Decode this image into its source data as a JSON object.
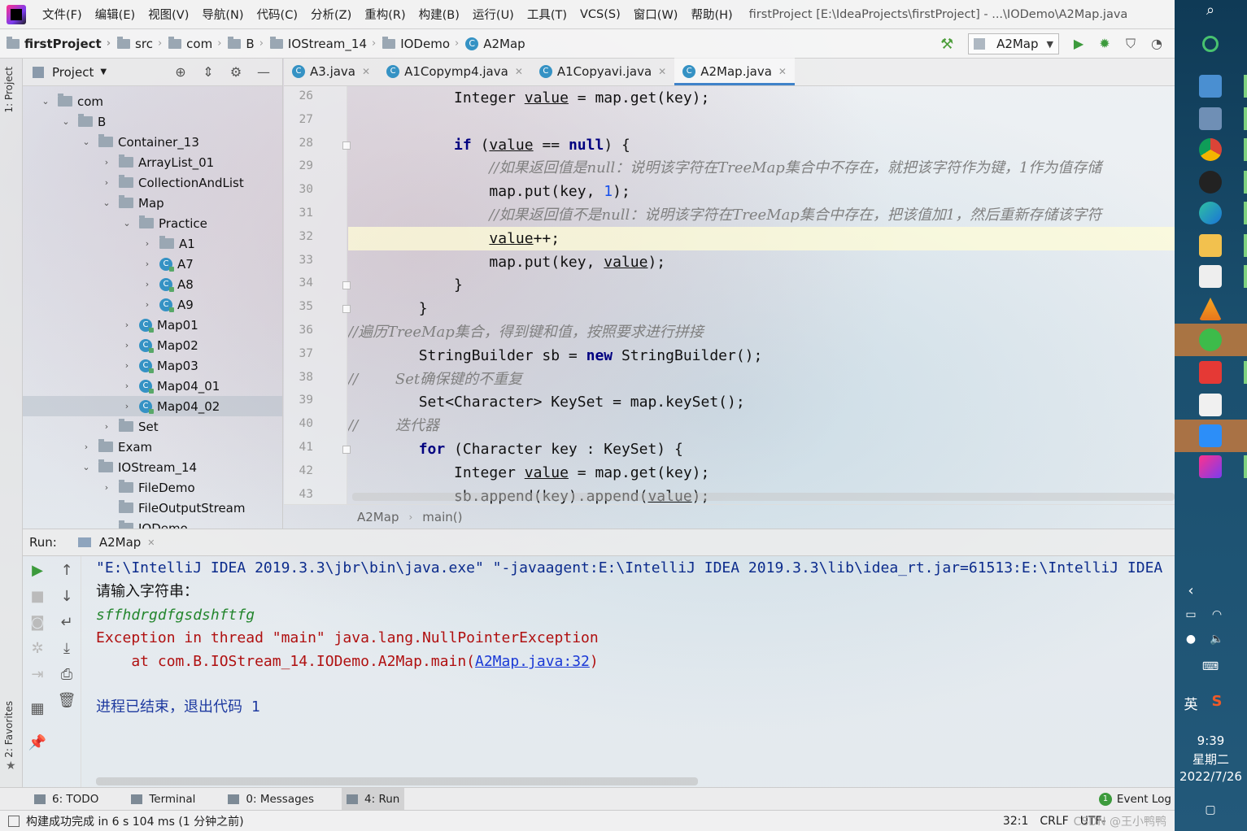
{
  "menubar": {
    "items": [
      "文件(F)",
      "编辑(E)",
      "视图(V)",
      "导航(N)",
      "代码(C)",
      "分析(Z)",
      "重构(R)",
      "构建(B)",
      "运行(U)",
      "工具(T)",
      "VCS(S)",
      "窗口(W)",
      "帮助(H)"
    ],
    "title": "firstProject [E:\\IdeaProjects\\firstProject] - ...\\IODemo\\A2Map.java"
  },
  "navbar": {
    "crumbs": [
      "firstProject",
      "src",
      "com",
      "B",
      "IOStream_14",
      "IODemo",
      "A2Map"
    ],
    "run_config": "A2Map"
  },
  "sidebar": {
    "project_tab": "1: Project",
    "favorites_tab": "2: Favorites"
  },
  "project": {
    "title": "Project",
    "tree": [
      {
        "label": "com",
        "kind": "folder",
        "expanded": true
      },
      {
        "label": "B",
        "kind": "folder",
        "expanded": true
      },
      {
        "label": "Container_13",
        "kind": "folder",
        "expanded": true
      },
      {
        "label": "ArrayList_01",
        "kind": "folder",
        "expanded": false
      },
      {
        "label": "CollectionAndList",
        "kind": "folder",
        "expanded": false
      },
      {
        "label": "Map",
        "kind": "folder",
        "expanded": true
      },
      {
        "label": "Practice",
        "kind": "folder",
        "expanded": true
      },
      {
        "label": "A1",
        "kind": "folder",
        "expanded": false
      },
      {
        "label": "A7",
        "kind": "class",
        "expanded": false
      },
      {
        "label": "A8",
        "kind": "class",
        "expanded": false
      },
      {
        "label": "A9",
        "kind": "class",
        "expanded": false
      },
      {
        "label": "Map01",
        "kind": "class",
        "expanded": false
      },
      {
        "label": "Map02",
        "kind": "class",
        "expanded": false
      },
      {
        "label": "Map03",
        "kind": "class",
        "expanded": false
      },
      {
        "label": "Map04_01",
        "kind": "class",
        "expanded": false
      },
      {
        "label": "Map04_02",
        "kind": "class",
        "expanded": false,
        "selected": true
      },
      {
        "label": "Set",
        "kind": "folder",
        "expanded": false
      },
      {
        "label": "Exam",
        "kind": "folder",
        "expanded": false
      },
      {
        "label": "IOStream_14",
        "kind": "folder",
        "expanded": true
      },
      {
        "label": "FileDemo",
        "kind": "folder",
        "expanded": false
      },
      {
        "label": "FileOutputStream",
        "kind": "folder",
        "expanded": null
      },
      {
        "label": "IODemo",
        "kind": "folder",
        "expanded": true
      }
    ]
  },
  "tabs": [
    {
      "label": "A3.java",
      "active": false
    },
    {
      "label": "A1Copymp4.java",
      "active": false
    },
    {
      "label": "A1Copyavi.java",
      "active": false
    },
    {
      "label": "A2Map.java",
      "active": true
    }
  ],
  "editor": {
    "current_line": 32,
    "lines": [
      {
        "n": 26,
        "code": "            Integer value = map.get(key);"
      },
      {
        "n": 27,
        "code": ""
      },
      {
        "n": 28,
        "code": "            if (value == null) {"
      },
      {
        "n": 29,
        "code": "                //如果返回值是null：说明该字符在TreeMap集合中不存在，就把该字符作为键，1作为值存储"
      },
      {
        "n": 30,
        "code": "                map.put(key, 1);"
      },
      {
        "n": 31,
        "code": "                //如果返回值不是null：说明该字符在TreeMap集合中存在，把该值加1，然后重新存储该字符"
      },
      {
        "n": 32,
        "code": "                value++;"
      },
      {
        "n": 33,
        "code": "                map.put(key, value);"
      },
      {
        "n": 34,
        "code": "            }"
      },
      {
        "n": 35,
        "code": "        }"
      },
      {
        "n": 36,
        "code": "//遍历TreeMap集合，得到键和值，按照要求进行拼接"
      },
      {
        "n": 37,
        "code": "        StringBuilder sb = new StringBuilder();"
      },
      {
        "n": 38,
        "code": "//        Set确保键的不重复"
      },
      {
        "n": 39,
        "code": "        Set<Character> KeySet = map.keySet();"
      },
      {
        "n": 40,
        "code": "//        迭代器"
      },
      {
        "n": 41,
        "code": "        for (Character key : KeySet) {"
      },
      {
        "n": 42,
        "code": "            Integer value = map.get(key);"
      },
      {
        "n": 43,
        "code": "            sb.append(key).append(value);"
      }
    ],
    "breadcrumb": [
      "A2Map",
      "main()"
    ]
  },
  "run": {
    "label": "Run:",
    "tab": "A2Map",
    "console": [
      {
        "type": "cmd",
        "text": "\"E:\\IntelliJ IDEA 2019.3.3\\jbr\\bin\\java.exe\" \"-javaagent:E:\\IntelliJ IDEA 2019.3.3\\lib\\idea_rt.jar=61513:E:\\IntelliJ IDEA"
      },
      {
        "type": "out",
        "text": "请输入字符串："
      },
      {
        "type": "in",
        "text": "sffhdrgdfgsdshftfg"
      },
      {
        "type": "err",
        "text": "Exception in thread \"main\" java.lang.NullPointerException"
      },
      {
        "type": "err_at",
        "prefix": "    at com.B.IOStream_14.IODemo.A2Map.main(",
        "link": "A2Map.java:32",
        "suffix": ")"
      },
      {
        "type": "blank",
        "text": ""
      },
      {
        "type": "exit",
        "text": "进程已结束，退出代码 1"
      }
    ]
  },
  "bottom_tabs": [
    {
      "label": "6: TODO",
      "active": false
    },
    {
      "label": "Terminal",
      "active": false
    },
    {
      "label": "0: Messages",
      "active": false
    },
    {
      "label": "4: Run",
      "active": true
    }
  ],
  "event_log": "Event Log",
  "status": {
    "message": "构建成功完成 in 6 s 104 ms (1 分钟之前)",
    "position": "32:1",
    "line_sep": "CRLF",
    "encoding": "UTF-",
    "watermark": "CSDN @王小鸭鸭"
  },
  "taskbar": {
    "time": "9:39",
    "weekday": "星期二",
    "date": "2022/7/26",
    "ime": "英",
    "colors": {
      "wechat_highlight": "#c37a3c",
      "active_app": "#b97540"
    }
  }
}
